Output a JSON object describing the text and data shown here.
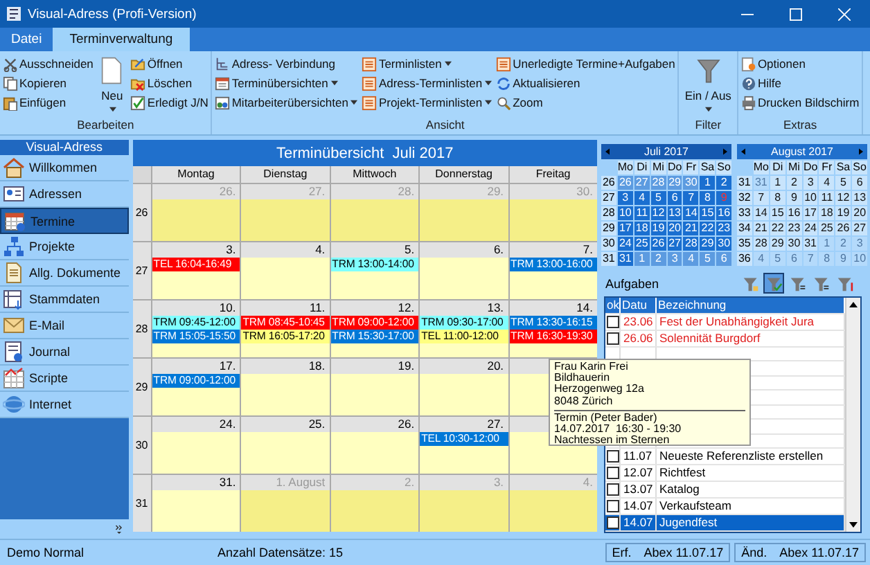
{
  "window": {
    "title": "Visual-Adress (Profi-Version)"
  },
  "tabs": [
    {
      "label": "Datei",
      "selected": false
    },
    {
      "label": "Terminverwaltung",
      "selected": true
    }
  ],
  "ribbon": [
    {
      "label": "Bearbeiten",
      "buttons": [
        {
          "label": "Ausschneiden",
          "kind": "small",
          "dropdown": false
        },
        {
          "label": "Kopieren",
          "kind": "small",
          "dropdown": false
        },
        {
          "label": "Einfügen",
          "kind": "small",
          "dropdown": false
        },
        {
          "label": "Neu",
          "kind": "large",
          "dropdown": true
        },
        {
          "label": "Öffnen",
          "kind": "small",
          "dropdown": false
        },
        {
          "label": "Löschen",
          "kind": "small",
          "dropdown": false
        },
        {
          "label": "Erledigt J/N",
          "kind": "small",
          "dropdown": false
        }
      ]
    },
    {
      "label": "Ansicht",
      "buttons": [
        {
          "label": "Adress- Verbindung",
          "kind": "small",
          "dropdown": false
        },
        {
          "label": "Terminübersichten",
          "kind": "small",
          "dropdown": true
        },
        {
          "label": "Mitarbeiterübersichten",
          "kind": "small",
          "dropdown": true
        },
        {
          "label": "Terminlisten",
          "kind": "small",
          "dropdown": true
        },
        {
          "label": "Adress-Terminlisten",
          "kind": "small",
          "dropdown": true
        },
        {
          "label": "Projekt-Terminlisten",
          "kind": "small",
          "dropdown": true
        },
        {
          "label": "Unerledigte Termine+Aufgaben",
          "kind": "small",
          "dropdown": false
        },
        {
          "label": "Aktualisieren",
          "kind": "small",
          "dropdown": false
        },
        {
          "label": "Zoom",
          "kind": "small",
          "dropdown": false
        }
      ]
    },
    {
      "label": "Filter",
      "buttons": [
        {
          "label": "Ein / Aus",
          "kind": "large",
          "dropdown": true
        }
      ]
    },
    {
      "label": "Extras",
      "buttons": [
        {
          "label": "Optionen",
          "kind": "small",
          "dropdown": false
        },
        {
          "label": "Hilfe",
          "kind": "small",
          "dropdown": false
        },
        {
          "label": "Drucken Bildschirm",
          "kind": "small",
          "dropdown": false
        }
      ]
    }
  ],
  "sidebar": {
    "title": "Visual-Adress",
    "items": [
      {
        "label": "Willkommen",
        "selected": false
      },
      {
        "label": "Adressen",
        "selected": false
      },
      {
        "label": "Termine",
        "selected": true
      },
      {
        "label": "Projekte",
        "selected": false
      },
      {
        "label": "Allg. Dokumente",
        "selected": false
      },
      {
        "label": "Stammdaten",
        "selected": false
      },
      {
        "label": "E-Mail",
        "selected": false
      },
      {
        "label": "Journal",
        "selected": false
      },
      {
        "label": "Scripte",
        "selected": false
      },
      {
        "label": "Internet",
        "selected": false
      }
    ]
  },
  "calendar": {
    "title": "Terminübersicht  Juli 2017",
    "weekdays": [
      "Montag",
      "Dienstag",
      "Mittwoch",
      "Donnerstag",
      "Freitag"
    ],
    "weeks": [
      {
        "week": "26",
        "days": [
          {
            "date": "26.",
            "other_month": true
          },
          {
            "date": "27.",
            "other_month": true
          },
          {
            "date": "28.",
            "other_month": true
          },
          {
            "date": "29.",
            "other_month": true
          },
          {
            "date": "30.",
            "other_month": true
          }
        ]
      },
      {
        "week": "27",
        "days": [
          {
            "date": "3.",
            "other_month": false,
            "events": [
              {
                "text": "TEL 16:04-16:49",
                "color": "#ff0000"
              }
            ]
          },
          {
            "date": "4.",
            "other_month": false
          },
          {
            "date": "5.",
            "other_month": false,
            "events": [
              {
                "text": "TRM 13:00-14:00",
                "color": "#80ffff"
              }
            ]
          },
          {
            "date": "6.",
            "other_month": false
          },
          {
            "date": "7.",
            "other_month": false,
            "events": [
              {
                "text": "TRM 13:00-16:00",
                "color": "#0078d7"
              }
            ]
          }
        ]
      },
      {
        "week": "28",
        "days": [
          {
            "date": "10.",
            "other_month": false,
            "events": [
              {
                "text": "TRM 09:45-12:00",
                "color": "#80ffff"
              },
              {
                "text": "TRM 15:05-15:50",
                "color": "#0078d7"
              }
            ]
          },
          {
            "date": "11.",
            "other_month": false,
            "events": [
              {
                "text": "TRM 08:45-10:45",
                "color": "#ff0000"
              },
              {
                "text": "TRM 16:05-17:20",
                "color": "#ffff80"
              }
            ]
          },
          {
            "date": "12.",
            "other_month": false,
            "events": [
              {
                "text": "TRM 09:00-12:00",
                "color": "#ff0000"
              },
              {
                "text": "TRM 15:30-17:00",
                "color": "#0078d7"
              }
            ]
          },
          {
            "date": "13.",
            "other_month": false,
            "events": [
              {
                "text": "TRM 09:30-17:00",
                "color": "#80ffff"
              },
              {
                "text": "TEL 11:00-12:00",
                "color": "#ffff80"
              }
            ]
          },
          {
            "date": "14.",
            "other_month": false,
            "events": [
              {
                "text": "TRM 13:30-16:15",
                "color": "#0078d7"
              },
              {
                "text": "TRM 16:30-19:30",
                "color": "#ff0000"
              }
            ]
          }
        ]
      },
      {
        "week": "29",
        "days": [
          {
            "date": "17.",
            "other_month": false,
            "events": [
              {
                "text": "TRM 09:00-12:00",
                "color": "#0078d7"
              }
            ]
          },
          {
            "date": "18.",
            "other_month": false
          },
          {
            "date": "19.",
            "other_month": false
          },
          {
            "date": "20.",
            "other_month": false
          },
          {
            "other_month": false
          }
        ]
      },
      {
        "week": "30",
        "days": [
          {
            "date": "24.",
            "other_month": false
          },
          {
            "date": "25.",
            "other_month": false
          },
          {
            "date": "26.",
            "other_month": false
          },
          {
            "date": "27.",
            "other_month": false,
            "events": [
              {
                "text": "TEL 10:30-12:00",
                "color": "#0078d7"
              }
            ]
          },
          {
            "other_month": false
          }
        ]
      },
      {
        "week": "31",
        "days": [
          {
            "date": "31.",
            "other_month": false
          },
          {
            "date": "1. August",
            "other_month": true
          },
          {
            "date": "2.",
            "other_month": true
          },
          {
            "date": "3.",
            "other_month": true
          },
          {
            "date": "4.",
            "other_month": true
          }
        ]
      }
    ]
  },
  "tooltip": {
    "lines": [
      "Frau Karin Frei",
      "Bildhauerin",
      "Herzogenweg 12a",
      "8048 Zürich"
    ],
    "details": [
      "Termin (Peter Bader)",
      "14.07.2017  16:30 - 19:30",
      "Nachtessen im Sternen"
    ]
  },
  "mini_calendars": [
    {
      "title": "Juli 2017",
      "selected": true,
      "weekdays": [
        "Mo",
        "Di",
        "Mi",
        "Do",
        "Fr",
        "Sa",
        "So"
      ],
      "weeks": [
        {
          "week": "26",
          "days": [
            {
              "d": "26",
              "kind": "other"
            },
            {
              "d": "27",
              "kind": "other"
            },
            {
              "d": "28",
              "kind": "other"
            },
            {
              "d": "29",
              "kind": "other"
            },
            {
              "d": "30",
              "kind": "other"
            },
            {
              "d": "1",
              "kind": "normal"
            },
            {
              "d": "2",
              "kind": "normal"
            }
          ]
        },
        {
          "week": "27",
          "days": [
            {
              "d": "3",
              "kind": "normal"
            },
            {
              "d": "4",
              "kind": "normal"
            },
            {
              "d": "5",
              "kind": "normal"
            },
            {
              "d": "6",
              "kind": "normal"
            },
            {
              "d": "7",
              "kind": "normal"
            },
            {
              "d": "8",
              "kind": "normal"
            },
            {
              "d": "9",
              "kind": "holiday"
            }
          ]
        },
        {
          "week": "28",
          "days": [
            {
              "d": "10",
              "kind": "normal"
            },
            {
              "d": "11",
              "kind": "normal"
            },
            {
              "d": "12",
              "kind": "normal"
            },
            {
              "d": "13",
              "kind": "normal"
            },
            {
              "d": "14",
              "kind": "normal"
            },
            {
              "d": "15",
              "kind": "normal"
            },
            {
              "d": "16",
              "kind": "normal"
            }
          ]
        },
        {
          "week": "29",
          "days": [
            {
              "d": "17",
              "kind": "normal"
            },
            {
              "d": "18",
              "kind": "normal"
            },
            {
              "d": "19",
              "kind": "normal"
            },
            {
              "d": "20",
              "kind": "normal"
            },
            {
              "d": "21",
              "kind": "normal"
            },
            {
              "d": "22",
              "kind": "normal"
            },
            {
              "d": "23",
              "kind": "normal"
            }
          ]
        },
        {
          "week": "30",
          "days": [
            {
              "d": "24",
              "kind": "normal"
            },
            {
              "d": "25",
              "kind": "normal"
            },
            {
              "d": "26",
              "kind": "normal"
            },
            {
              "d": "27",
              "kind": "normal"
            },
            {
              "d": "28",
              "kind": "normal"
            },
            {
              "d": "29",
              "kind": "normal"
            },
            {
              "d": "30",
              "kind": "normal"
            }
          ]
        },
        {
          "week": "31",
          "days": [
            {
              "d": "31",
              "kind": "normal"
            },
            {
              "d": "1",
              "kind": "other"
            },
            {
              "d": "2",
              "kind": "other"
            },
            {
              "d": "3",
              "kind": "other"
            },
            {
              "d": "4",
              "kind": "other"
            },
            {
              "d": "5",
              "kind": "other"
            },
            {
              "d": "6",
              "kind": "other"
            }
          ]
        }
      ]
    },
    {
      "title": "August 2017",
      "selected": false,
      "weekdays": [
        "Mo",
        "Di",
        "Mi",
        "Do",
        "Fr",
        "Sa",
        "So"
      ],
      "weeks": [
        {
          "week": "31",
          "days": [
            {
              "d": "31",
              "kind": "other"
            },
            {
              "d": "1",
              "kind": "normal"
            },
            {
              "d": "2",
              "kind": "normal"
            },
            {
              "d": "3",
              "kind": "normal"
            },
            {
              "d": "4",
              "kind": "normal"
            },
            {
              "d": "5",
              "kind": "normal"
            },
            {
              "d": "6",
              "kind": "normal"
            }
          ]
        },
        {
          "week": "32",
          "days": [
            {
              "d": "7",
              "kind": "normal"
            },
            {
              "d": "8",
              "kind": "normal"
            },
            {
              "d": "9",
              "kind": "normal"
            },
            {
              "d": "10",
              "kind": "normal"
            },
            {
              "d": "11",
              "kind": "normal"
            },
            {
              "d": "12",
              "kind": "normal"
            },
            {
              "d": "13",
              "kind": "normal"
            }
          ]
        },
        {
          "week": "33",
          "days": [
            {
              "d": "14",
              "kind": "normal"
            },
            {
              "d": "15",
              "kind": "normal"
            },
            {
              "d": "16",
              "kind": "normal"
            },
            {
              "d": "17",
              "kind": "normal"
            },
            {
              "d": "18",
              "kind": "normal"
            },
            {
              "d": "19",
              "kind": "normal"
            },
            {
              "d": "20",
              "kind": "normal"
            }
          ]
        },
        {
          "week": "34",
          "days": [
            {
              "d": "21",
              "kind": "normal"
            },
            {
              "d": "22",
              "kind": "normal"
            },
            {
              "d": "23",
              "kind": "normal"
            },
            {
              "d": "24",
              "kind": "normal"
            },
            {
              "d": "25",
              "kind": "normal"
            },
            {
              "d": "26",
              "kind": "normal"
            },
            {
              "d": "27",
              "kind": "normal"
            }
          ]
        },
        {
          "week": "35",
          "days": [
            {
              "d": "28",
              "kind": "normal"
            },
            {
              "d": "29",
              "kind": "normal"
            },
            {
              "d": "30",
              "kind": "normal"
            },
            {
              "d": "31",
              "kind": "normal"
            },
            {
              "d": "1",
              "kind": "other"
            },
            {
              "d": "2",
              "kind": "other"
            },
            {
              "d": "3",
              "kind": "other"
            }
          ]
        },
        {
          "week": "36",
          "days": [
            {
              "d": "4",
              "kind": "other"
            },
            {
              "d": "5",
              "kind": "other"
            },
            {
              "d": "6",
              "kind": "other"
            },
            {
              "d": "7",
              "kind": "other"
            },
            {
              "d": "8",
              "kind": "other"
            },
            {
              "d": "9",
              "kind": "other"
            },
            {
              "d": "10",
              "kind": "other"
            }
          ]
        }
      ]
    }
  ],
  "tasks": {
    "title": "Aufgaben",
    "filters": [
      {
        "selected": false
      },
      {
        "selected": true
      },
      {
        "selected": false
      },
      {
        "selected": false
      },
      {
        "selected": false
      }
    ],
    "columns": [
      "ok",
      "Datu",
      "Bezeichnung"
    ],
    "rows": [
      {
        "kind": "task",
        "date": "23.06",
        "title": "Fest der Unabhängigkeit Jura",
        "checked": false,
        "overdue": true,
        "selected": false
      },
      {
        "kind": "task",
        "date": "26.06",
        "title": "Solennität Burgdorf",
        "checked": false,
        "overdue": true,
        "selected": false
      },
      {
        "kind": "covered"
      },
      {
        "kind": "covered"
      },
      {
        "kind": "covered"
      },
      {
        "kind": "covered"
      },
      {
        "kind": "covered"
      },
      {
        "kind": "covered"
      },
      {
        "kind": "covered"
      },
      {
        "kind": "task",
        "date": "11.07",
        "title": "Neueste Referenzliste erstellen",
        "checked": false,
        "overdue": false,
        "selected": false
      },
      {
        "kind": "task",
        "date": "12.07",
        "title": "Richtfest",
        "checked": false,
        "overdue": false,
        "selected": false
      },
      {
        "kind": "task",
        "date": "13.07",
        "title": "Katalog",
        "checked": false,
        "overdue": false,
        "selected": false
      },
      {
        "kind": "task",
        "date": "14.07",
        "title": "Verkaufsteam",
        "checked": false,
        "overdue": false,
        "selected": false
      },
      {
        "kind": "task",
        "date": "14.07",
        "title": "Jugendfest",
        "checked": false,
        "overdue": false,
        "selected": true
      }
    ]
  },
  "status_bar": {
    "left": "Demo Normal",
    "count": "Anzahl Datensätze: 15",
    "fields": [
      {
        "label": "Erf.",
        "value": "Abex 11.07.17"
      },
      {
        "label": "Änd.",
        "value": "Abex 11.07.17"
      }
    ]
  }
}
